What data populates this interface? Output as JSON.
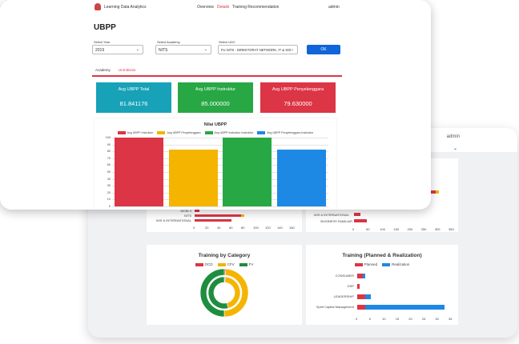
{
  "back": {
    "admin": "admin",
    "chart_data": [
      {
        "type": "bar",
        "orientation": "horizontal",
        "title": "",
        "categories": [
          "WCBI 3",
          "NITS",
          "WIS & INTERNATIONAL"
        ],
        "series": [
          {
            "name": "",
            "values": [
              0,
              0,
              0
            ]
          },
          {
            "name": "",
            "values": [
              0,
              0,
              0
            ]
          }
        ],
        "x_ticks": [
          "0",
          "20",
          "40",
          "60",
          "80",
          "100",
          "120",
          "140",
          "160"
        ],
        "bars": [
          {
            "red": 5,
            "yellow": 0
          },
          {
            "red": 85,
            "yellow": 6
          },
          {
            "red": 70,
            "yellow": 0
          }
        ]
      },
      {
        "type": "bar",
        "orientation": "horizontal",
        "title": "",
        "categories": [
          "WIS & INTERNATIONAL",
          "BUSINESS FAMILIAR"
        ],
        "series": [
          {
            "values": [
              18,
              38
            ]
          }
        ],
        "x_ticks": [
          "0",
          "50",
          "100",
          "150",
          "200",
          "250",
          "300",
          "350"
        ]
      },
      {
        "type": "pie",
        "title": "Training by Category",
        "legend": [
          "OCD",
          "CFV",
          "FV"
        ],
        "colors": [
          "#dc3545",
          "#f4b400",
          "#1e8e3e"
        ],
        "rings": [
          {
            "values": [
              1,
              49,
              50
            ]
          },
          {
            "values": [
              1,
              45,
              54
            ]
          }
        ]
      },
      {
        "type": "bar",
        "orientation": "horizontal",
        "title": "Training (Planned & Realization)",
        "legend": [
          "Planned",
          "Realization"
        ],
        "categories": [
          "CONSUMER",
          "DSP",
          "LEADERSHIP",
          "Spirit Capital Management"
        ],
        "series": [
          {
            "name": "Planned",
            "values": [
              2,
              1,
              3,
              3
            ]
          },
          {
            "name": "Realization",
            "values": [
              1,
              0,
              2,
              30
            ]
          }
        ],
        "x_ticks": [
          "0",
          "5",
          "10",
          "15",
          "20",
          "25",
          "30",
          "35"
        ]
      }
    ],
    "right_top_ticks": [
      "0",
      "50",
      "100",
      "150",
      "200",
      "250",
      "300",
      "350"
    ]
  },
  "nav": {
    "brand": "Learning Data Analytics",
    "links": [
      "Overview",
      "Details",
      "Training Recommendation"
    ],
    "user": "admin"
  },
  "page": {
    "title": "UBPP"
  },
  "filters": {
    "year_label": "Select Year",
    "year_value": "2019",
    "academy_label": "Select Academy",
    "academy_value": "NITS",
    "udc_label": "Select UDC",
    "udc_value": "FU NITS - DIREKTORAT NETWORK, IT & SOI",
    "ok": "OK"
  },
  "tabs": [
    "Academy",
    "Unit Bisnis"
  ],
  "kpis": [
    {
      "title": "Avg UBPP Total",
      "value": "81.841176",
      "color": "#17a2b8"
    },
    {
      "title": "Avg UBPP Instruktur",
      "value": "85.000000",
      "color": "#28a745"
    },
    {
      "title": "Avg UBPP Penyelenggara",
      "value": "79.630000",
      "color": "#dc3545"
    }
  ],
  "chart_data": {
    "type": "bar",
    "title": "Nilai UBPP",
    "categories": [
      "Avg UBPP Instruktur",
      "Avg UBPP Penyelenggara",
      "Avg UBPP Instruktur Instruktor",
      "Avg UBPP Penyelenggara Instruktor"
    ],
    "series": [
      {
        "name": "Avg UBPP Instruktur",
        "values": [
          100
        ],
        "color": "#dc3545"
      },
      {
        "name": "Avg UBPP Penyelenggara",
        "values": [
          82
        ],
        "color": "#f4b400"
      },
      {
        "name": "Avg UBPP Instruktur Instruktor",
        "values": [
          100
        ],
        "color": "#28a745"
      },
      {
        "name": "Avg UBPP Penyelenggara Instruktor",
        "values": [
          82
        ],
        "color": "#1e88e5"
      }
    ],
    "ylim": [
      0,
      100
    ],
    "y_ticks": [
      "100",
      "90",
      "80",
      "70",
      "60",
      "50",
      "40",
      "30",
      "20",
      "10",
      "0"
    ]
  }
}
